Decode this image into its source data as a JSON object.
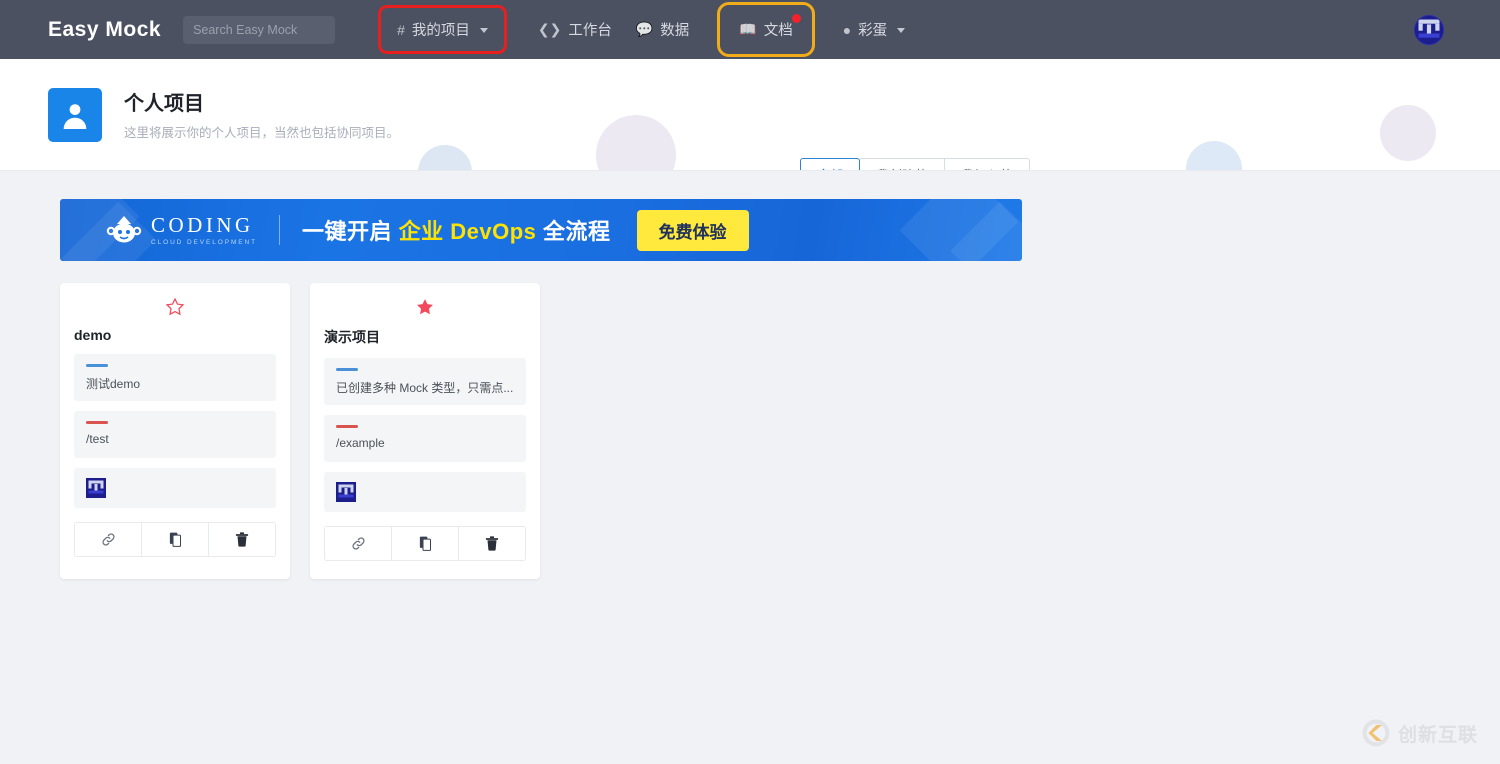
{
  "navbar": {
    "brand": "Easy Mock",
    "search": {
      "placeholder": "Search Easy Mock",
      "value": ""
    },
    "items": [
      {
        "label": "我的项目",
        "icon": "hash-icon",
        "has_caret": true,
        "highlight": "red",
        "badge": false
      },
      {
        "label": "工作台",
        "icon": "code-brackets-icon",
        "has_caret": false,
        "highlight": "none",
        "badge": false
      },
      {
        "label": "数据",
        "icon": "chat-icon",
        "has_caret": false,
        "highlight": "none",
        "badge": false
      },
      {
        "label": "文档",
        "icon": "book-icon",
        "has_caret": false,
        "highlight": "amber",
        "badge": true
      },
      {
        "label": "彩蛋",
        "icon": "egg-icon",
        "has_caret": true,
        "highlight": "none",
        "badge": false
      }
    ],
    "user_menu": {
      "avatar_alt": "user-avatar"
    }
  },
  "page_header": {
    "title": "个人项目",
    "subtitle": "这里将展示你的个人项目，当然也包括协同项目。",
    "icon": "person-icon",
    "filters": [
      {
        "label": "全部",
        "active": true
      },
      {
        "label": "我创建的",
        "active": false
      },
      {
        "label": "我加入的",
        "active": false
      }
    ]
  },
  "banner": {
    "logo_name": "CODING",
    "logo_tagline": "CLOUD DEVELOPMENT",
    "headline_1": "一键开启 ",
    "headline_hl": "企业 DevOps",
    "headline_2": " 全流程",
    "cta_label": "免费体验"
  },
  "projects": [
    {
      "title": "demo",
      "starred": false,
      "star_icon": "star-outline-icon",
      "description": "测试demo",
      "path": "/test",
      "description_accent": "#4a90d9",
      "path_accent": "#d9534f",
      "actions": [
        {
          "name": "copy-link-button",
          "icon": "link-icon"
        },
        {
          "name": "clone-project-button",
          "icon": "copy-icon"
        },
        {
          "name": "delete-project-button",
          "icon": "trash-icon"
        }
      ]
    },
    {
      "title": "演示项目",
      "starred": true,
      "star_icon": "star-filled-icon",
      "description": "已创建多种 Mock 类型，只需点...",
      "path": "/example",
      "description_accent": "#4a90d9",
      "path_accent": "#d9534f",
      "actions": [
        {
          "name": "copy-link-button",
          "icon": "link-icon"
        },
        {
          "name": "clone-project-button",
          "icon": "copy-icon"
        },
        {
          "name": "delete-project-button",
          "icon": "trash-icon"
        }
      ]
    }
  ],
  "watermark": {
    "text": "创新互联",
    "icon": "cx-logo-icon"
  },
  "colors": {
    "navbar_bg": "#4c5161",
    "page_bg": "#f0f2f5",
    "accent_blue": "#2b85d6",
    "star_red": "#f24a5c",
    "badge_red": "#f5222d",
    "highlight_red": "#e81f1f",
    "highlight_amber": "#f0ac19",
    "banner_blue": "#1b74e4",
    "banner_yellow": "#ffe93d"
  }
}
